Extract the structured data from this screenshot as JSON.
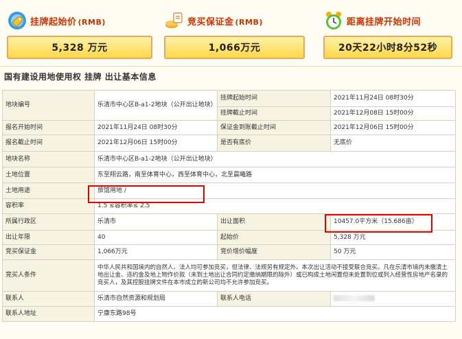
{
  "header": {
    "cards": [
      {
        "title": "挂牌起始价",
        "unit": "(RMB)",
        "value": "5,328 万元",
        "icon": "price-tag-icon"
      },
      {
        "title": "竞买保证金",
        "unit": "(RMB)",
        "value": "1,066万元",
        "icon": "deposit-coins-icon"
      },
      {
        "title": "距离挂牌开始时间",
        "unit": "",
        "value": "20天22小时8分52秒",
        "icon": "alarm-clock-icon"
      }
    ]
  },
  "section_title": "国有建设用地使用权 挂牌 出让基本信息",
  "table": {
    "parcel_no_label": "地块编号",
    "parcel_no_value": "乐清市中心区B-a1-2地块（公开出让地块）",
    "listing_start_label": "挂牌起始时间",
    "listing_start_value": "2021年11月24日 08时30分",
    "listing_end_label": "挂牌截止时间",
    "listing_end_value": "2021年12月08日 15时00分",
    "reg_start_label": "报名开始时间",
    "reg_start_value": "2021年11月24日 08时30分",
    "deposit_deadline_label": "保证金到账截止时间",
    "deposit_deadline_value": "2021年12月06日 15时00分",
    "reg_end_label": "报名截止时间",
    "reg_end_value": "2021年12月06日 15时00分",
    "reserve_label": "是否有底价",
    "reserve_value": "无底价",
    "parcel_name_label": "地块名称",
    "parcel_name_value": "乐清市中心区B-a1-2地块（公开出让地块）",
    "location_label": "土地位置",
    "location_value": "东至翔云路，南至体育中心，西至体育中心，北至晨曦路",
    "use_label": "土地用途",
    "use_value": "旅馆用地 /",
    "far_label": "容积率",
    "far_value": "1.5 ≤容积率≤ 2.5",
    "district_label": "所属行政区",
    "district_value": "乐清市",
    "area_label": "出让面积",
    "area_value": "10457.0平方米（15.686亩）",
    "term_label": "出让年限",
    "term_value": "40",
    "start_price_label": "起始价",
    "start_price_value": "5,328 万元",
    "bid_deposit_label": "竞买保证金",
    "bid_deposit_value": "1,066万元",
    "increment_label": "竞价增价幅度",
    "increment_value": "50 万元",
    "conditions_label": "竞买人条件",
    "conditions_value": "中华人民共和国境内的自然人、法人均可参加竞买，但法律、法规另有规定外。本次出让活动不接受联合竞买。凡在乐清市境内未缴清土地出让金、违约金及地上物作价款（未到土地出让合同约定缴纳期限的除外）或已构成土地闲置但未处置到位或列入经营性房地产名录的竞买人，及其控股挂牌文件在本市成立的新公司均不允许参加竞买。",
    "contact_label": "联系人",
    "contact_value": "乐清市自然资源和规划局",
    "phone_label": "联系人电话",
    "address_label": "联系人地址",
    "address_value": "宁康东路98号"
  }
}
